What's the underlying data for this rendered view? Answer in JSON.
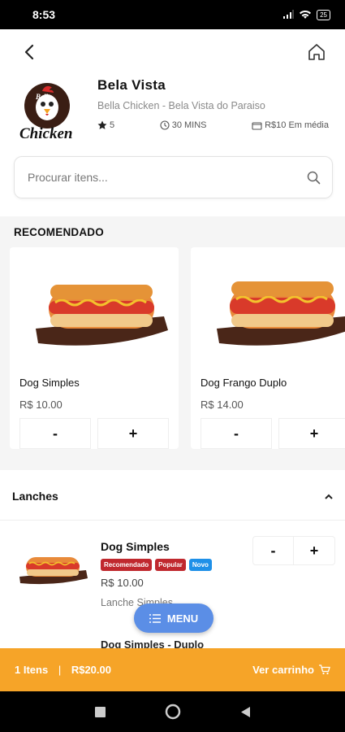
{
  "status_bar": {
    "time": "8:53",
    "battery": "25"
  },
  "restaurant": {
    "name": "Bela Vista",
    "address": "Bella Chicken - Bela Vista do Paraiso",
    "rating": "5",
    "delivery_time": "30 MINS",
    "avg_price": "R$10 Em média",
    "logo_text": "Bella Chicken"
  },
  "search": {
    "placeholder": "Procurar itens..."
  },
  "recommended": {
    "title": "RECOMENDADO",
    "items": [
      {
        "name": "Dog Simples",
        "price": "R$ 10.00",
        "minus": "-",
        "plus": "+"
      },
      {
        "name": "Dog Frango Duplo",
        "price": "R$ 14.00",
        "minus": "-",
        "plus": "+"
      }
    ]
  },
  "category": {
    "title": "Lanches"
  },
  "product": {
    "name": "Dog Simples",
    "badges": [
      {
        "label": "Recomendado",
        "color": "#c0282e"
      },
      {
        "label": "Popular",
        "color": "#c0282e"
      },
      {
        "label": "Novo",
        "color": "#1e90e8"
      }
    ],
    "price": "R$ 10.00",
    "category": "Lanche Simples",
    "minus": "-",
    "plus": "+"
  },
  "next_product": {
    "name": "Dog Simples - Duplo"
  },
  "menu_button": {
    "label": "MENU"
  },
  "cart": {
    "count": "1 Itens",
    "separator": "|",
    "total": "R$20.00",
    "view_label": "Ver carrinho"
  },
  "colors": {
    "accent": "#f6a428",
    "fab": "#5b8ee6"
  }
}
